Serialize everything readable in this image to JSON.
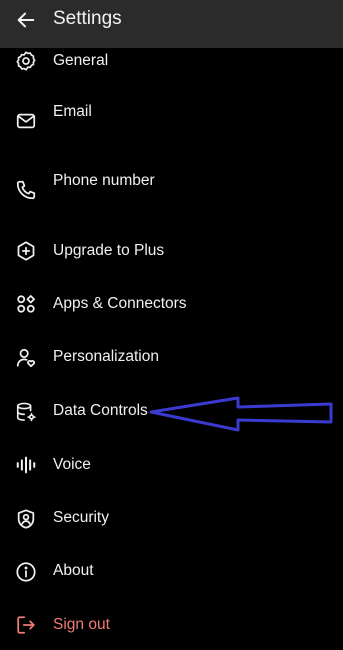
{
  "header": {
    "title": "Settings",
    "back_icon": "arrow-left-icon",
    "background": "#2b2b2b"
  },
  "menu": {
    "items": [
      {
        "key": "general",
        "label": "General",
        "icon": "gear-icon"
      },
      {
        "key": "email",
        "label": "Email",
        "icon": "mail-icon"
      },
      {
        "key": "phone",
        "label": "Phone number",
        "icon": "phone-icon"
      },
      {
        "key": "upgrade",
        "label": "Upgrade to Plus",
        "icon": "plus-badge-icon"
      },
      {
        "key": "apps",
        "label": "Apps & Connectors",
        "icon": "apps-icon"
      },
      {
        "key": "personalization",
        "label": "Personalization",
        "icon": "person-heart-icon"
      },
      {
        "key": "data-controls",
        "label": "Data Controls",
        "icon": "database-gear-icon"
      },
      {
        "key": "voice",
        "label": "Voice",
        "icon": "waveform-icon"
      },
      {
        "key": "security",
        "label": "Security",
        "icon": "shield-user-icon"
      },
      {
        "key": "about",
        "label": "About",
        "icon": "info-icon"
      },
      {
        "key": "sign-out",
        "label": "Sign out",
        "icon": "sign-out-icon"
      }
    ]
  },
  "colors": {
    "background": "#000000",
    "text": "#f0f0f0",
    "danger": "#f07c74",
    "annotation": "#3a3ad0"
  },
  "annotation": {
    "icon": "arrow-left-outline-icon",
    "points_to": "Data Controls"
  }
}
